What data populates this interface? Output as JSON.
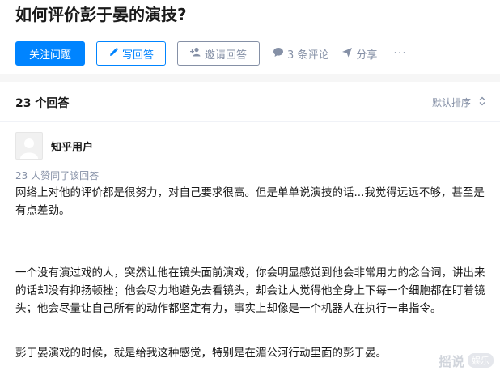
{
  "question": {
    "title": "如何评价彭于晏的演技?"
  },
  "actions": {
    "follow_label": "关注问题",
    "write_label": "写回答",
    "invite_label": "邀请回答",
    "comments_label": "3 条评论",
    "share_label": "分享",
    "more_label": "···"
  },
  "answers_header": {
    "count_label": "23 个回答",
    "sort_label": "默认排序"
  },
  "answer": {
    "author_name": "知乎用户",
    "votes_text": "23 人赞同了该回答",
    "paragraphs": [
      "网络上对他的评价都是很努力，对自己要求很高。但是单单说演技的话...我觉得远远不够，甚至是有点差劲。",
      "一个没有演过戏的人，突然让他在镜头面前演戏，你会明显感觉到他会非常用力的念台词，讲出来的话却没有抑扬顿挫；他会尽力地避免去看镜头，却会让人觉得他全身上下每一个细胞都在盯着镜头；他会尽量让自己所有的动作都坚定有力，事实上却像是一个机器人在执行一串指令。",
      "彭于晏演戏的时候，就是给我这种感觉，特别是在湄公河行动里面的彭于晏。"
    ]
  },
  "watermark": {
    "text": "摇说",
    "badge": "娱乐"
  },
  "colors": {
    "brand_blue": "#0084ff",
    "meta_gray": "#8590a6"
  }
}
